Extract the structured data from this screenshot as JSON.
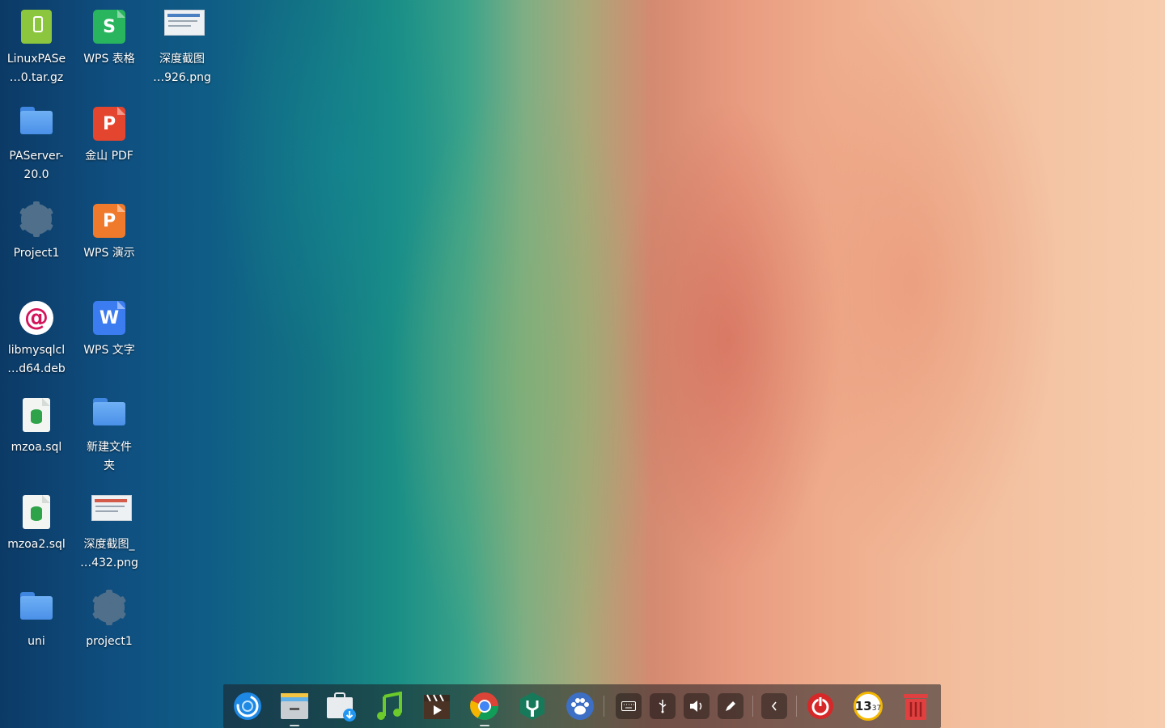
{
  "desktop_icons": [
    {
      "line1": "LinuxPASe",
      "line2": "…0.tar.gz"
    },
    {
      "line1": "WPS 表格",
      "line2": ""
    },
    {
      "line1": "深度截图",
      "line2": "…926.png"
    },
    {
      "line1": "PAServer-",
      "line2": "20.0"
    },
    {
      "line1": "金山 PDF",
      "line2": ""
    },
    {
      "line1": "Project1",
      "line2": ""
    },
    {
      "line1": "WPS 演示",
      "line2": ""
    },
    {
      "line1": "libmysqlcl",
      "line2": "…d64.deb"
    },
    {
      "line1": "WPS 文字",
      "line2": ""
    },
    {
      "line1": "mzoa.sql",
      "line2": ""
    },
    {
      "line1": "新建文件",
      "line2": "夹"
    },
    {
      "line1": "mzoa2.sql",
      "line2": ""
    },
    {
      "line1": "深度截图_",
      "line2": "…432.png"
    },
    {
      "line1": "uni",
      "line2": ""
    },
    {
      "line1": "project1",
      "line2": ""
    }
  ],
  "dock": {
    "clock": {
      "hour": "13",
      "minute": "37"
    },
    "apps": [
      "launcher-icon",
      "file-manager-icon",
      "app-store-icon",
      "music-icon",
      "movie-icon",
      "chrome-icon",
      "terminal-app-icon",
      "paw-app-icon"
    ],
    "tray": [
      "keyboard-icon",
      "usb-icon",
      "volume-icon",
      "pen-icon",
      "collapse-arrow-icon"
    ],
    "power_color": "#d62828",
    "trash_color": "#e04040"
  }
}
